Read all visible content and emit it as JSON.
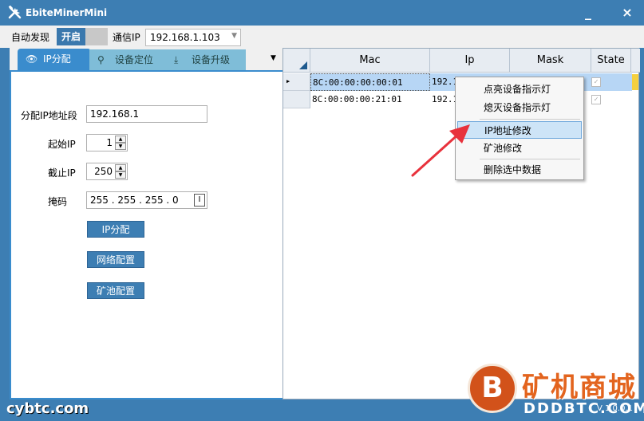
{
  "window": {
    "title": "EbiteMinerMini",
    "minimize": "_",
    "close": "×"
  },
  "toolbar": {
    "auto_discover_label": "自动发现",
    "toggle_on_label": "开启",
    "comm_ip_label": "通信IP",
    "comm_ip_value": "192.168.1.103"
  },
  "tabs": [
    {
      "label": "IP分配",
      "icon": "eye-icon"
    },
    {
      "label": "设备定位",
      "icon": "location-pin-icon"
    },
    {
      "label": "设备升级",
      "icon": "download-icon"
    }
  ],
  "form": {
    "ip_segment_label": "分配IP地址段",
    "ip_segment_value": "192.168.1",
    "start_ip_label": "起始IP",
    "start_ip_value": "1",
    "end_ip_label": "截止IP",
    "end_ip_value": "250",
    "mask_label": "掩码",
    "mask_value": "255 . 255 . 255 . 0",
    "btn_ip_assign": "IP分配",
    "btn_network_config": "网络配置",
    "btn_pool_config": "矿池配置"
  },
  "grid": {
    "columns": [
      "Mac",
      "Ip",
      "Mask",
      "State"
    ],
    "rows": [
      {
        "mac": "8C:00:00:00:00:01",
        "ip": "192.1"
      },
      {
        "mac": "8C:00:00:00:21:01",
        "ip": "192.1"
      }
    ]
  },
  "context_menu": {
    "items": [
      "点亮设备指示灯",
      "熄灭设备指示灯",
      "IP地址修改",
      "矿池修改",
      "删除选中数据"
    ]
  },
  "watermark": {
    "left_text": "cybtc.com",
    "logo_letter": "B",
    "brand_cn": "矿机商城",
    "brand_en": "DDDBTC.COM",
    "version": "V 1.0.0.1"
  },
  "colors": {
    "titlebar": "#3d7eb3",
    "tab_active": "#3a8ccd",
    "tab_inactive": "#7fbdd8",
    "selection": "#b7d6f5",
    "arrow": "#e8323c"
  }
}
